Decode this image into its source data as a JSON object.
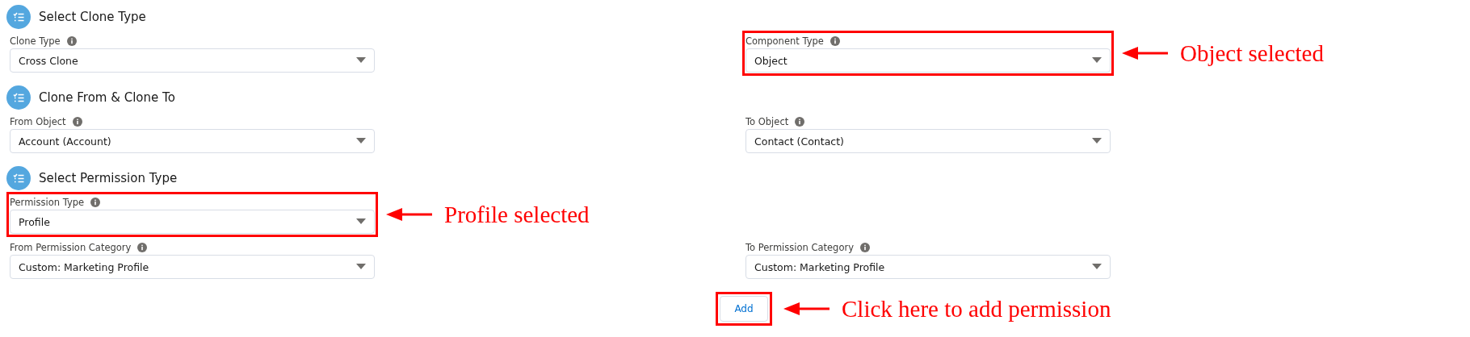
{
  "sections": [
    {
      "title": "Select Clone Type",
      "rows": [
        {
          "left": {
            "label": "Clone Type",
            "value": "Cross Clone",
            "highlighted": false
          },
          "right": {
            "label": "Component Type",
            "value": "Object",
            "highlighted": true,
            "annotation": "Object selected"
          }
        }
      ]
    },
    {
      "title": "Clone From & Clone To",
      "rows": [
        {
          "left": {
            "label": "From Object",
            "value": "Account (Account)",
            "highlighted": false
          },
          "right": {
            "label": "To Object",
            "value": "Contact (Contact)",
            "highlighted": false
          }
        }
      ]
    },
    {
      "title": "Select Permission Type",
      "rows": [
        {
          "left": {
            "label": "Permission Type",
            "value": "Profile",
            "highlighted": true,
            "annotation": "Profile selected"
          }
        },
        {
          "left": {
            "label": "From Permission Category",
            "value": "Custom: Marketing Profile",
            "highlighted": false
          },
          "right": {
            "label": "To Permission Category",
            "value": "Custom: Marketing Profile",
            "highlighted": false
          }
        }
      ]
    }
  ],
  "add_button": {
    "label": "Add",
    "highlighted": true,
    "annotation": "Click here to add permission"
  }
}
